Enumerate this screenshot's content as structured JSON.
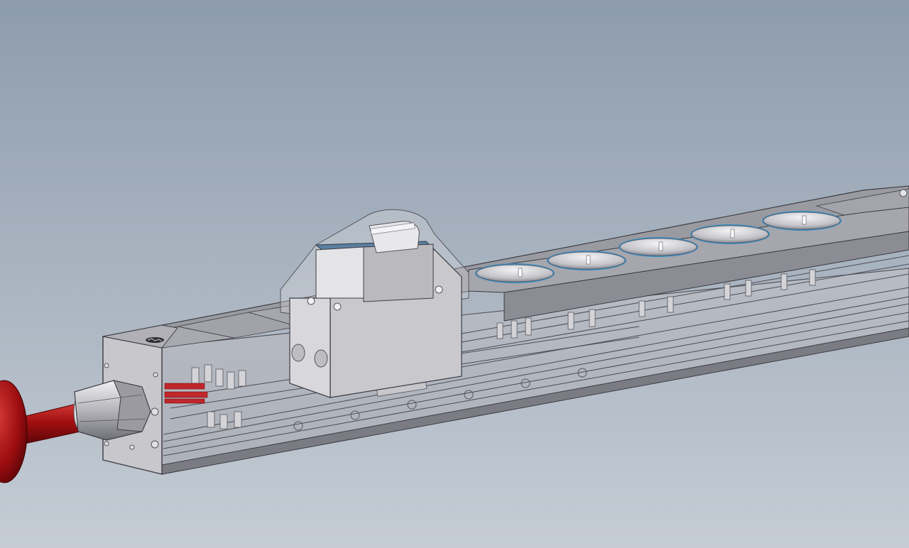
{
  "viewport": {
    "background_top": "#8d9cad",
    "background_bottom": "#c5ccd4"
  },
  "model": {
    "housing_color": "#c9c8cc",
    "housing_dark": "#8f8f96",
    "cable_color": "#a30f12",
    "socket_outline_color": "#3a8bbf",
    "socket_count": 5,
    "breaker_count": 1,
    "cable_gland_count": 1
  },
  "icons": {
    "end_cap_logo": "logo-icon"
  }
}
